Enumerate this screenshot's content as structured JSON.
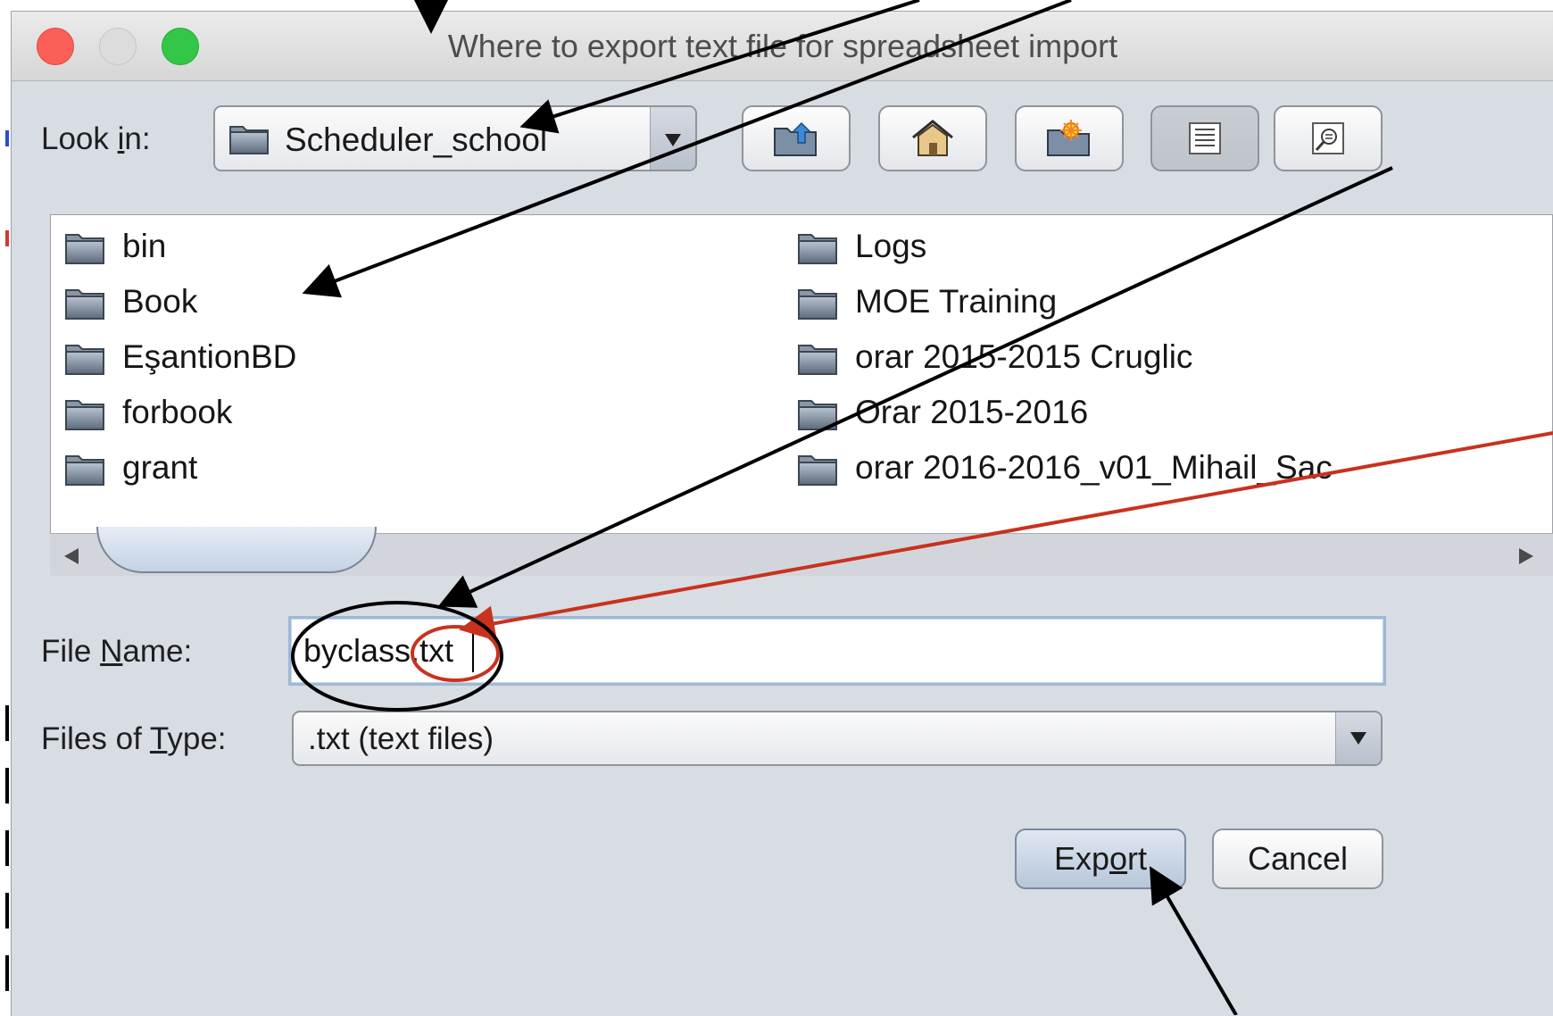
{
  "window": {
    "title": "Where to export text file for spreadsheet import"
  },
  "toolbar": {
    "look_in_prefix": "Look ",
    "look_in_mnemonic": "i",
    "look_in_suffix": "n:",
    "current_folder": "Scheduler_school",
    "buttons": [
      "up-one-level",
      "home",
      "create-new-folder",
      "list-view",
      "details-view"
    ]
  },
  "files": {
    "left_column": [
      "bin",
      "Book",
      "EşantionBD",
      "forbook",
      "grant"
    ],
    "right_column": [
      "Logs",
      "MOE Training",
      "orar 2015-2015 Cruglic",
      "Orar 2015-2016",
      "orar 2016-2016_v01_Mihail_Sac"
    ]
  },
  "file_name": {
    "label_prefix": "File ",
    "label_mnemonic": "N",
    "label_suffix": "ame:",
    "value": "byclass.txt"
  },
  "file_type": {
    "label_prefix": "Files of ",
    "label_mnemonic": "T",
    "label_suffix": "ype:",
    "selected": ".txt (text files)"
  },
  "actions": {
    "export_prefix": "Exp",
    "export_mnemonic": "o",
    "export_suffix": "rt",
    "cancel": "Cancel"
  },
  "colors": {
    "annotation_black": "#000000",
    "annotation_red": "#c8321e"
  }
}
